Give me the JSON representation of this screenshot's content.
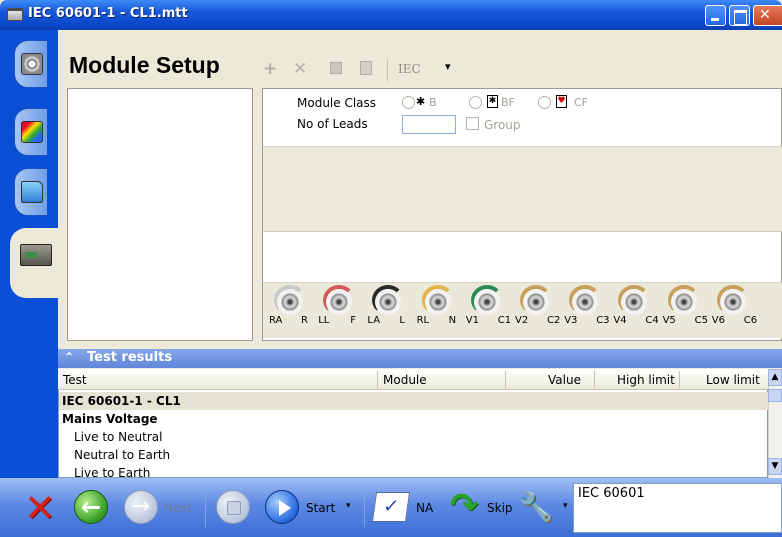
{
  "window": {
    "title": "IEC 60601-1 - CL1.mtt"
  },
  "page": {
    "title": "Module Setup"
  },
  "toolbar": {
    "standard": "IEC",
    "dropdown_arrow": "▾",
    "icons": [
      "add-icon",
      "delete-icon",
      "save-icon",
      "doc-icon"
    ]
  },
  "rail": {
    "tabs": [
      "gear-icon",
      "edit-icon",
      "folder-icon",
      "device-icon"
    ]
  },
  "module": {
    "class_label": "Module Class",
    "classes": [
      {
        "symbol": "✱",
        "label": "B"
      },
      {
        "symbol": "✱",
        "label": "BF"
      },
      {
        "symbol": "♥",
        "label": "CF"
      }
    ],
    "leads_label": "No of Leads",
    "leads_value": "",
    "group_label": "Group",
    "group_checked": false
  },
  "electrodes": [
    {
      "label": "RA",
      "color": "#c9c9c9"
    },
    {
      "label": "R",
      "color": ""
    },
    {
      "label": "LL",
      "color": "#d45a5a"
    },
    {
      "label": "F",
      "color": ""
    },
    {
      "label": "LA",
      "color": "#2a2a2a"
    },
    {
      "label": "L",
      "color": ""
    },
    {
      "label": "RL",
      "color": "#e3b44a"
    },
    {
      "label": "N",
      "color": ""
    },
    {
      "label": "V1",
      "color": "#2e8a55"
    },
    {
      "label": "C1",
      "color": ""
    },
    {
      "label": "V2",
      "color": "#c8a05c"
    },
    {
      "label": "C2",
      "color": ""
    },
    {
      "label": "V3",
      "color": "#c8a05c"
    },
    {
      "label": "C3",
      "color": ""
    },
    {
      "label": "V4",
      "color": "#c8a05c"
    },
    {
      "label": "C4",
      "color": ""
    },
    {
      "label": "V5",
      "color": "#c8a05c"
    },
    {
      "label": "C5",
      "color": ""
    },
    {
      "label": "V6",
      "color": "#c8a05c"
    },
    {
      "label": "C6",
      "color": ""
    }
  ],
  "results": {
    "title": "Test results",
    "collapse_symbol": "⌃",
    "columns": [
      "Test",
      "Module",
      "Value",
      "High limit",
      "Low limit"
    ],
    "rows": [
      {
        "test": "IEC 60601-1 - CL1",
        "kind": "group"
      },
      {
        "test": "Mains Voltage",
        "kind": "section"
      },
      {
        "test": "Live to Neutral",
        "kind": "item"
      },
      {
        "test": "Neutral to Earth",
        "kind": "item"
      },
      {
        "test": "Live to Earth",
        "kind": "item"
      }
    ]
  },
  "bottom": {
    "next": "Next",
    "start": "Start",
    "na": "NA",
    "skip": "Skip",
    "caret": "▾",
    "status": "IEC 60601"
  },
  "colors": {
    "titlebar": "#1758d8",
    "rail": "#0b4fd6",
    "results_header": "#6f92dd",
    "bottom_bar": "#5d89e3"
  }
}
